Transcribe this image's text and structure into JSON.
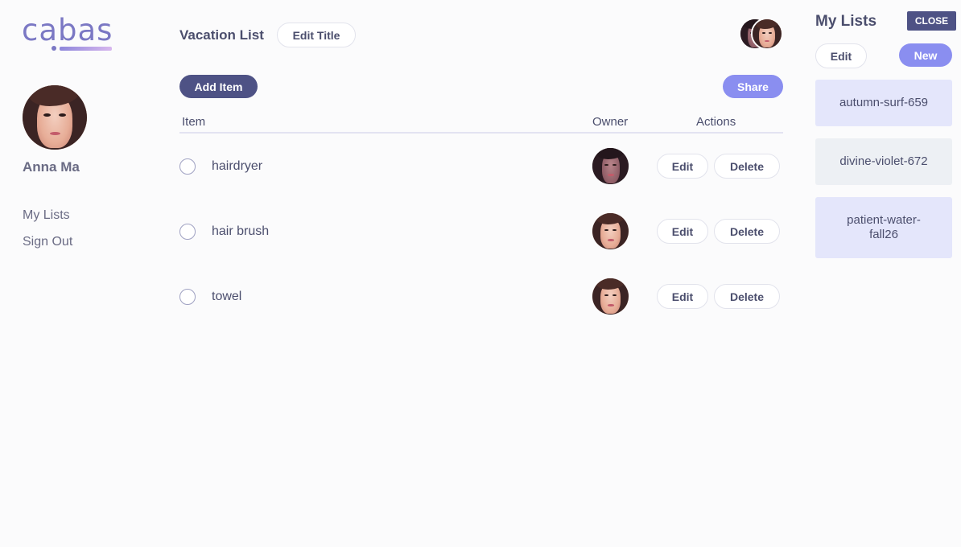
{
  "brand": {
    "logo_text": "cabas",
    "accent": "#7b78c4"
  },
  "user": {
    "name": "Anna Ma"
  },
  "sidebar": {
    "items": [
      {
        "label": "My Lists"
      },
      {
        "label": "Sign Out"
      }
    ]
  },
  "list": {
    "title": "Vacation List",
    "edit_title_label": "Edit Title",
    "add_item_label": "Add Item",
    "share_label": "Share",
    "columns": {
      "item": "Item",
      "owner": "Owner",
      "actions": "Actions"
    },
    "items": [
      {
        "name": "hairdryer",
        "owner_avatar": "dark",
        "edit_label": "Edit",
        "delete_label": "Delete"
      },
      {
        "name": "hair brush",
        "owner_avatar": "light",
        "edit_label": "Edit",
        "delete_label": "Delete"
      },
      {
        "name": "towel",
        "owner_avatar": "light",
        "edit_label": "Edit",
        "delete_label": "Delete"
      }
    ]
  },
  "my_lists": {
    "title": "My Lists",
    "close_label": "CLOSE",
    "edit_label": "Edit",
    "new_label": "New",
    "lists": [
      {
        "name": "autumn-surf-659"
      },
      {
        "name": "divine-violet-672"
      },
      {
        "name": "patient-water-fall26"
      }
    ]
  },
  "colors": {
    "primary_dark": "#4e5285",
    "primary_light": "#8a8ef0",
    "card_active": "#e4e6fb",
    "card_muted": "#edf0f4"
  }
}
